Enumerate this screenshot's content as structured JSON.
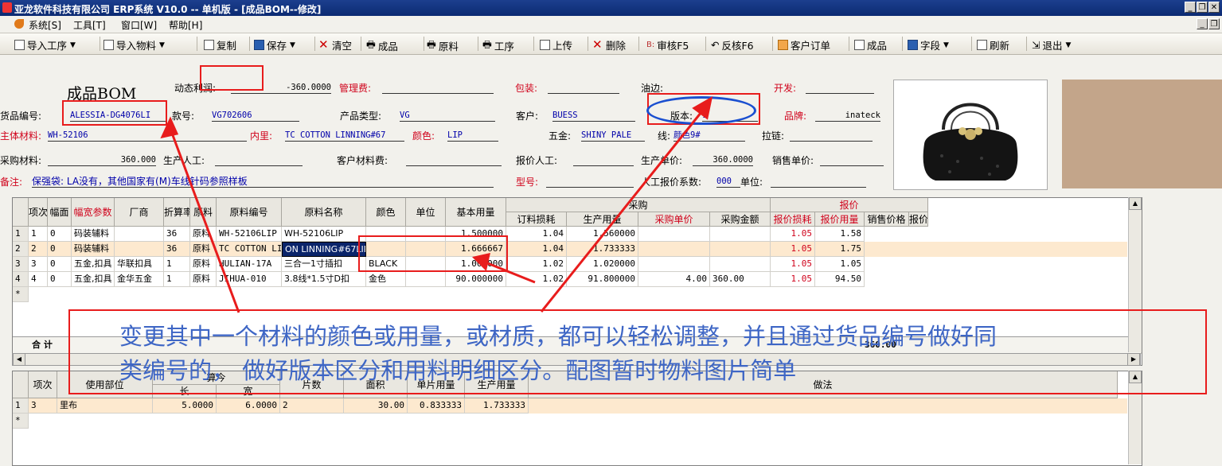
{
  "window": {
    "title": "亚龙软件科技有限公司 ERP系统 V10.0 -- 单机版 - [成品BOM--修改]"
  },
  "menu": [
    "系统[S]",
    "工具[T]",
    "窗口[W]",
    "帮助[H]"
  ],
  "toolbar": {
    "import_process": "导入工序",
    "import_material": "导入物料",
    "copy": "复制",
    "save": "保存",
    "clear": "清空",
    "product": "成品",
    "raw": "原料",
    "process": "工序",
    "upload": "上传",
    "delete": "删除",
    "audit": "审核F5",
    "unaudit": "反核F6",
    "customer_order": "客户订单",
    "product2": "成品",
    "fields": "字段",
    "refresh": "刷新",
    "exit": "退出"
  },
  "form": {
    "heading": "成品BOM",
    "dynamic_profit_label": "动态利润:",
    "dynamic_profit_value": "-360.0000",
    "mgmt_fee_label": "管理费:",
    "packing_label": "包装:",
    "edge_oil_label": "油边:",
    "develop_label": "开发:",
    "item_no_label": "货品编号:",
    "item_no_value": "ALESSIA-DG4076LI",
    "style_no_label": "款号:",
    "style_no_value": "VG702606",
    "product_type_label": "产品类型:",
    "product_type_value": "VG",
    "customer_label": "客户:",
    "customer_value": "BUESS",
    "version_label": "版本:",
    "version_value": "1",
    "brand_label": "品牌:",
    "brand_value": "inateck",
    "main_material_label": "主体材料:",
    "main_material_value": "WH-52106",
    "lining_label": "内里:",
    "lining_value": "TC COTTON LINNING#67",
    "color_label": "颜色:",
    "color_value": "LIP",
    "hardware_label": "五金:",
    "hardware_value": "SHINY PALE",
    "thread_label": "线:",
    "thread_value": "颜色9#",
    "zipper_label": "拉链:",
    "purchase_material_label": "采购材料:",
    "purchase_material_value": "360.000",
    "labor_label": "生产人工:",
    "customer_material_fee_label": "客户材料费:",
    "quote_labor_label": "报价人工:",
    "production_price_label": "生产单价:",
    "production_price_value": "360.0000",
    "sales_price_label": "销售单价:",
    "remark_label": "备注:",
    "remark_value": "保强袋: LA没有，其他国家有(M)车线针码参照样板",
    "model_label": "型号:",
    "labor_quote_factor_label": "人工报价系数:",
    "labor_quote_factor_value": "000",
    "unit_label": "单位:"
  },
  "grid": {
    "group_purchase": "采购",
    "group_quote": "报价",
    "columns": [
      "项次",
      "幅面",
      "幅宽参数",
      "厂商",
      "折算率",
      "原料",
      "原料编号",
      "原料名称",
      "颜色",
      "单位",
      "基本用量",
      "订料损耗",
      "生产用量",
      "采购单价",
      "采购金额",
      "报价损耗",
      "报价用量",
      "销售价格",
      "报价金额"
    ],
    "rows": [
      {
        "idx": "1",
        "seq": "1",
        "fm": "0",
        "param": "码装辅料",
        "vendor": "",
        "rate": "36",
        "type": "原料",
        "code": "WH-52106LIP",
        "name": "WH-52106LIP",
        "color": "",
        "unit": "",
        "base": "1.500000",
        "loss": "1.04",
        "prod": "1.560000",
        "pprice": "",
        "pamt": "",
        "qloss": "1.05",
        "qty": "1.58"
      },
      {
        "idx": "2",
        "seq": "2",
        "fm": "0",
        "param": "码装辅料",
        "vendor": "",
        "rate": "36",
        "type": "原料",
        "code": "TC COTTON LINNING",
        "name": "ON LINNING#67LIP",
        "color": "",
        "unit": "",
        "base": "1.666667",
        "loss": "1.04",
        "prod": "1.733333",
        "pprice": "",
        "pamt": "",
        "qloss": "1.05",
        "qty": "1.75"
      },
      {
        "idx": "3",
        "seq": "3",
        "fm": "0",
        "param": "五金,扣具",
        "vendor": "华联扣具",
        "rate": "1",
        "type": "原料",
        "code": "HULIAN-17A",
        "name": "三合一1寸插扣",
        "color": "BLACK",
        "unit": "",
        "base": "1.000000",
        "loss": "1.02",
        "prod": "1.020000",
        "pprice": "",
        "pamt": "",
        "qloss": "1.05",
        "qty": "1.05"
      },
      {
        "idx": "4",
        "seq": "4",
        "fm": "0",
        "param": "五金,扣具",
        "vendor": "金华五金",
        "rate": "1",
        "type": "原料",
        "code": "JIHUA-010",
        "name": "3.8线*1.5寸D扣",
        "color": "金色",
        "unit": "",
        "base": "90.000000",
        "loss": "1.02",
        "prod": "91.800000",
        "pprice": "4.00",
        "pamt": "360.00",
        "qloss": "1.05",
        "qty": "94.50"
      }
    ],
    "new_row_marker": "*",
    "total_label": "合 计",
    "total_value": "360.00"
  },
  "subgrid": {
    "dims_label": "算今",
    "columns": [
      "项次",
      "使用部位",
      "长",
      "宽",
      "片数",
      "面积",
      "单片用量",
      "生产用量",
      "做法"
    ],
    "rows": [
      {
        "idx": "1",
        "seq": "3",
        "part": "里布",
        "len": "5.0000",
        "wid": "6.0000",
        "pcs": "2",
        "area": "30.00",
        "unit": "0.833333",
        "prod": "1.733333"
      }
    ]
  },
  "annotation": {
    "line1": "变更其中一个材料的颜色或用量，或材质，都可以轻松调整，并且通过货品编号做好同",
    "line2": "类编号的， 做好版本区分和用料明细区分。配图暂时物料图片简单"
  },
  "colors": {
    "title_bar": "#0b2a72",
    "accent_red": "#d0021b",
    "annotation_blue": "#3e66c5",
    "row_highlight": "#fde9cf"
  }
}
